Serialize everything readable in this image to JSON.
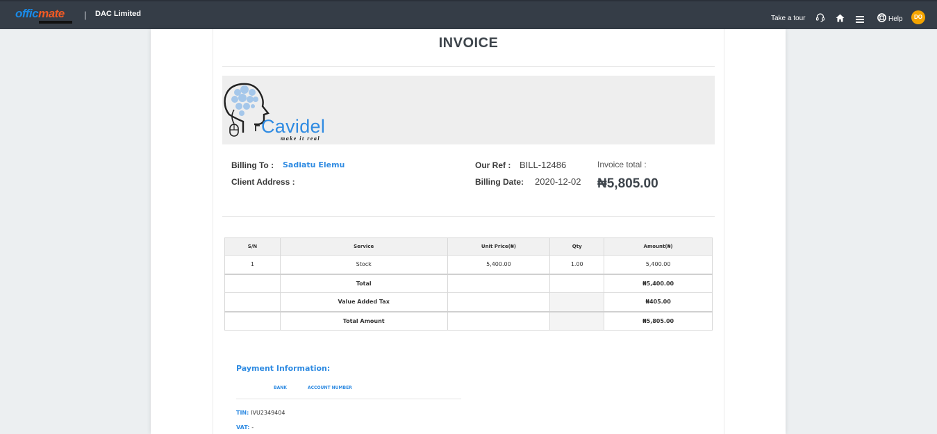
{
  "navbar": {
    "logo_part1": "offic",
    "logo_part2": "mate",
    "separator": "|",
    "company": "DAC Limited",
    "take_tour": "Take a tour",
    "help": "Help",
    "avatar_initials": "DO",
    "icons": [
      "headset-icon",
      "home-icon",
      "menu-icon",
      "help-icon"
    ]
  },
  "invoice": {
    "title": "INVOICE",
    "brand_name": "Cavidel",
    "brand_tagline": "make it real",
    "billing_to_label": "Billing To :",
    "billing_to_value": "Sadiatu Elemu",
    "client_address_label": "Client Address :",
    "our_ref_label": "Our Ref :",
    "our_ref_value": "BILL-12486",
    "billing_date_label": "Billing Date:",
    "billing_date_value": "2020-12-02",
    "invoice_total_label": "Invoice total :",
    "invoice_total_value": "₦5,805.00"
  },
  "table": {
    "headers": [
      "S/N",
      "Service",
      "Unit Price(₦)",
      "Qty",
      "Amount(₦)"
    ],
    "rows": [
      {
        "sn": "1",
        "service": "Stock",
        "unit_price": "5,400.00",
        "qty": "1.00",
        "amount": "5,400.00"
      }
    ],
    "total_label": "Total",
    "total_value": "₦5,400.00",
    "vat_label": "Value Added Tax",
    "vat_value": "₦405.00",
    "total_amount_label": "Total Amount",
    "total_amount_value": "₦5,805.00"
  },
  "payment": {
    "title": "Payment Information:",
    "col_bank": "BANK",
    "col_account": "ACCOUNT NUMBER",
    "tin_label": "TIN:",
    "tin_value": "IVU2349404",
    "vat_label": "VAT:",
    "vat_value": "-"
  },
  "colors": {
    "navbar": "#353d47",
    "accent_blue": "#2f8be2",
    "avatar": "#f4a400",
    "logo_blue": "#1a8ae6",
    "logo_orange": "#f15a24"
  }
}
